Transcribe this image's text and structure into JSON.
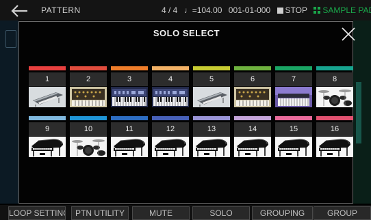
{
  "header": {
    "title": "PATTERN",
    "beat": "4 / 4",
    "tempo": "♩=104.00",
    "position": "001-01-000",
    "stop_label": "STOP",
    "sample_pad_label": "SAMPLE PAD"
  },
  "modal": {
    "title": "SOLO SELECT"
  },
  "pads": [
    {
      "number": "1",
      "color": "#e8403f",
      "image": "synth-silver"
    },
    {
      "number": "2",
      "color": "#e04c3d",
      "image": "synth-modular"
    },
    {
      "number": "3",
      "color": "#ee7d2a",
      "image": "synth-keyboard"
    },
    {
      "number": "4",
      "color": "#f2b166",
      "image": "synth-keyboard"
    },
    {
      "number": "5",
      "color": "#c7cb32",
      "image": "synth-silver"
    },
    {
      "number": "6",
      "color": "#6fb23f",
      "image": "synth-modular"
    },
    {
      "number": "7",
      "color": "#1aa564",
      "image": "synth-workstation"
    },
    {
      "number": "8",
      "color": "#17a48f",
      "image": "drum-kit"
    },
    {
      "number": "9",
      "color": "#7fb8de",
      "image": "grand-piano"
    },
    {
      "number": "10",
      "color": "#1f95d6",
      "image": "drum-kit"
    },
    {
      "number": "11",
      "color": "#2d6dc2",
      "image": "grand-piano"
    },
    {
      "number": "12",
      "color": "#4760b8",
      "image": "grand-piano"
    },
    {
      "number": "13",
      "color": "#9994d6",
      "image": "grand-piano"
    },
    {
      "number": "14",
      "color": "#c3a3d8",
      "image": "grand-piano"
    },
    {
      "number": "15",
      "color": "#e86a9b",
      "image": "grand-piano"
    },
    {
      "number": "16",
      "color": "#e0506f",
      "image": "grand-piano"
    }
  ],
  "bottom_buttons": [
    {
      "label": "LOOP SETTING"
    },
    {
      "label": "PTN UTILITY"
    },
    {
      "label": "MUTE"
    },
    {
      "label": "SOLO"
    },
    {
      "label": "GROUPING"
    },
    {
      "label": "GROUP"
    }
  ]
}
